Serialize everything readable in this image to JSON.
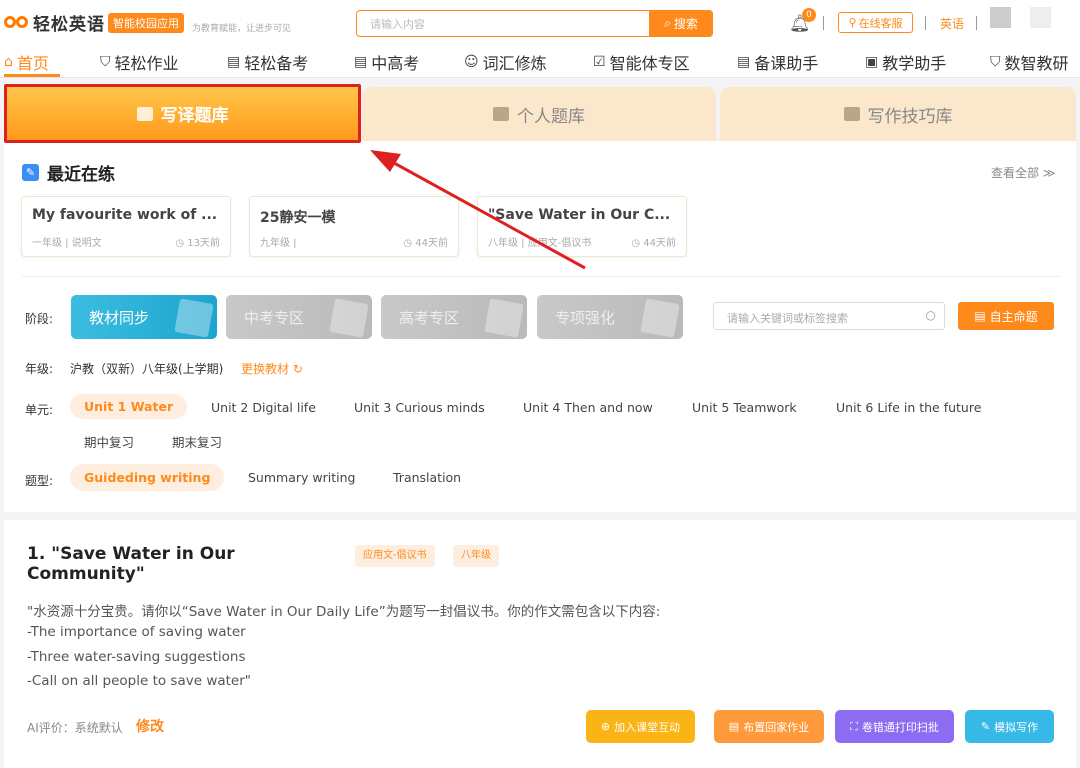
{
  "header": {
    "logo_text": "轻松英语",
    "badge": "智能校园应用",
    "slogan": "为教育赋能，让进步可见",
    "search_placeholder": "请输入内容",
    "search_button": "搜索",
    "notification_count": "0",
    "service": "在线客服",
    "language": "英语"
  },
  "nav": {
    "items": [
      {
        "label": "首页",
        "icon": "home-icon"
      },
      {
        "label": "轻松作业",
        "icon": "shield-icon"
      },
      {
        "label": "轻松备考",
        "icon": "document-icon"
      },
      {
        "label": "中高考",
        "icon": "document-icon"
      },
      {
        "label": "词汇修炼",
        "icon": "person-book-icon"
      },
      {
        "label": "智能体专区",
        "icon": "check-doc-icon"
      },
      {
        "label": "备课助手",
        "icon": "document-icon"
      },
      {
        "label": "教学助手",
        "icon": "book-icon"
      },
      {
        "label": "数智教研",
        "icon": "shield-icon"
      }
    ],
    "active": "首页"
  },
  "tabs": [
    {
      "label": "写译题库",
      "active": true
    },
    {
      "label": "个人题库",
      "active": false
    },
    {
      "label": "写作技巧库",
      "active": false
    }
  ],
  "recent": {
    "title": "最近在练",
    "view_all": "查看全部 ≫",
    "items": [
      {
        "title": "My favourite work of ...",
        "meta": "一年级 | 说明文",
        "time": "13天前"
      },
      {
        "title": "25静安一模",
        "meta": "九年级 |",
        "time": "44天前"
      },
      {
        "title": "\"Save Water in Our C...",
        "meta": "八年级 | 应用文-倡议书",
        "time": "44天前"
      }
    ]
  },
  "filters": {
    "stage_label": "阶段:",
    "stages": [
      {
        "label": "教材同步",
        "enabled": true
      },
      {
        "label": "中考专区",
        "enabled": false
      },
      {
        "label": "高考专区",
        "enabled": false
      },
      {
        "label": "专项强化",
        "enabled": false
      }
    ],
    "keyword_placeholder": "请输入关键词或标签搜索",
    "make_button": "自主命题",
    "grade_label": "年级:",
    "grade_value": "沪教（双新）八年级(上学期)",
    "grade_change": "更换教材",
    "unit_label": "单元:",
    "units": [
      "Unit 1 Water",
      "Unit 2 Digital life",
      "Unit 3 Curious minds",
      "Unit 4 Then and now",
      "Unit 5 Teamwork",
      "Unit 6 Life in the future",
      "期中复习",
      "期末复习"
    ],
    "unit_selected": "Unit 1 Water",
    "type_label": "题型:",
    "types": [
      "Guideding writing",
      "Summary writing",
      "Translation"
    ],
    "type_selected": "Guideding writing"
  },
  "question": {
    "number": "1.",
    "title": "\"Save Water in Our Community\"",
    "tags": [
      "应用文-倡议书",
      "八年级"
    ],
    "lines": [
      "\"水资源十分宝贵。请你以“Save Water in Our Daily Life”为题写一封倡议书。你的作文需包含以下内容:",
      "-The importance of saving water",
      "-Three water-saving suggestions",
      "-Call on all people to save water\""
    ],
    "ai_label": "AI评价：系统默认",
    "ai_edit": "修改",
    "actions": [
      {
        "label": "加入课堂互动",
        "color": "#fbb416"
      },
      {
        "label": "布置回家作业",
        "color": "#ff9a3c"
      },
      {
        "label": "卷错通打印扫批",
        "color": "#8b6cf2"
      },
      {
        "label": "模拟写作",
        "color": "#37b9e8"
      }
    ]
  },
  "colors": {
    "accent": "#ff8a1c",
    "annotation": "#e02020"
  }
}
